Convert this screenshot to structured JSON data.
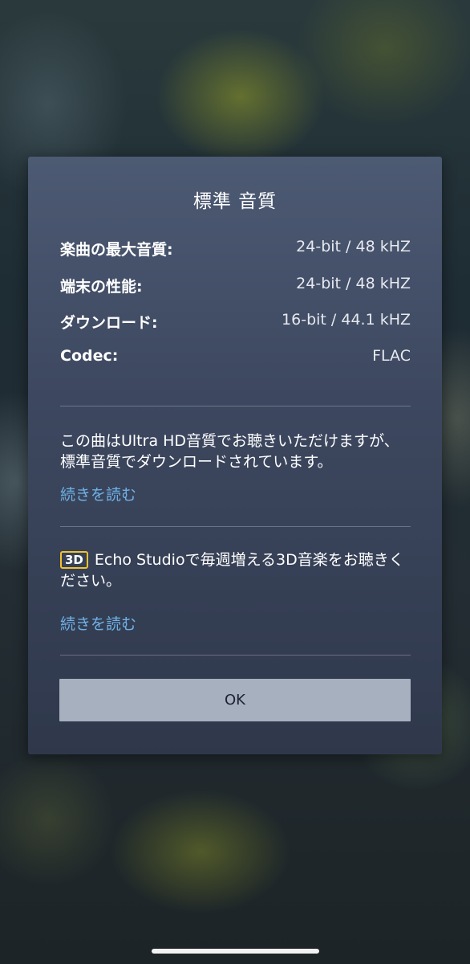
{
  "dialog": {
    "title": "標準 音質",
    "specs": [
      {
        "label": "楽曲の最大音質:",
        "value": "24-bit / 48 kHZ"
      },
      {
        "label": "端末の性能:",
        "value": "24-bit / 48 kHZ"
      },
      {
        "label": "ダウンロード:",
        "value": "16-bit / 44.1 kHZ"
      },
      {
        "label": "Codec:",
        "value": "FLAC"
      }
    ],
    "info_text": "この曲はUltra HD音質でお聴きいただけますが、標準音質でダウンロードされています。",
    "read_more_1": "続きを読む",
    "badge_3d": "3D",
    "echo_text": "Echo Studioで毎週増える3D音楽をお聴きください。",
    "read_more_2": "続きを読む",
    "ok_label": "OK"
  },
  "colors": {
    "dialog_top": "#4d5a73",
    "dialog_bottom": "#2f384b",
    "link": "#6fb1e6",
    "badge_border": "#f2c12e",
    "ok_button_bg": "#a7b0bf"
  }
}
